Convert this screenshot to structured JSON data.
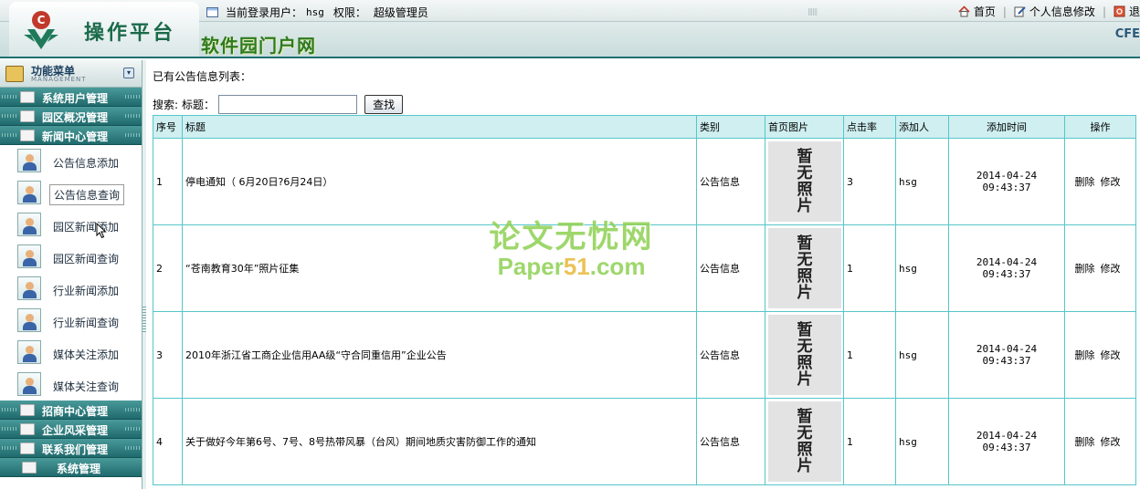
{
  "header": {
    "app_title": "操作平台",
    "site_title": "软件园门户网",
    "right_tag": "CFE",
    "user_prefix": "当前登录用户：",
    "username": "hsg",
    "perm_label": "权限：",
    "role": "超级管理员",
    "links": {
      "home": "首页",
      "profile": "个人信息修改",
      "exit": "退"
    }
  },
  "sidebar": {
    "title": "功能菜单",
    "subtitle": "MANAGEMENT",
    "categories": [
      "系统用户管理",
      "园区概况管理",
      "新闻中心管理",
      "招商中心管理",
      "企业风采管理",
      "联系我们管理",
      "系统管理"
    ],
    "news_items": [
      "公告信息添加",
      "公告信息查询",
      "园区新闻添加",
      "园区新闻查询",
      "行业新闻添加",
      "行业新闻查询",
      "媒体关注添加",
      "媒体关注查询"
    ]
  },
  "main": {
    "list_title": "已有公告信息列表：",
    "search_label": "搜索:",
    "title_label": "标题：",
    "search_value": "",
    "search_button": "查找",
    "columns": [
      "序号",
      "标题",
      "类别",
      "首页图片",
      "点击率",
      "添加人",
      "添加时间",
      "操作"
    ],
    "no_photo": [
      "暂",
      "无",
      "照",
      "片"
    ],
    "rows": [
      {
        "no": "1",
        "title": "停电通知（ 6月20日?6月24日）",
        "category": "公告信息",
        "clicks": "3",
        "author": "hsg",
        "time": "2014-04-24 09:43:37",
        "delete": "删除",
        "edit": "修改"
      },
      {
        "no": "2",
        "title": "“苍南教育30年”照片征集",
        "category": "公告信息",
        "clicks": "1",
        "author": "hsg",
        "time": "2014-04-24 09:43:37",
        "delete": "删除",
        "edit": "修改"
      },
      {
        "no": "3",
        "title": "2010年浙江省工商企业信用AA级“守合同重信用”企业公告",
        "category": "公告信息",
        "clicks": "1",
        "author": "hsg",
        "time": "2014-04-24 09:43:37",
        "delete": "删除",
        "edit": "修改"
      },
      {
        "no": "4",
        "title": "关于做好今年第6号、7号、8号热带风暴（台风）期间地质灾害防御工作的通知",
        "category": "公告信息",
        "clicks": "1",
        "author": "hsg",
        "time": "2014-04-24 09:43:37",
        "delete": "删除",
        "edit": "修改"
      }
    ]
  },
  "watermark": {
    "line1": "论文无忧网",
    "line2a": "Paper",
    "line2b": "51",
    "line2c": ".com"
  }
}
